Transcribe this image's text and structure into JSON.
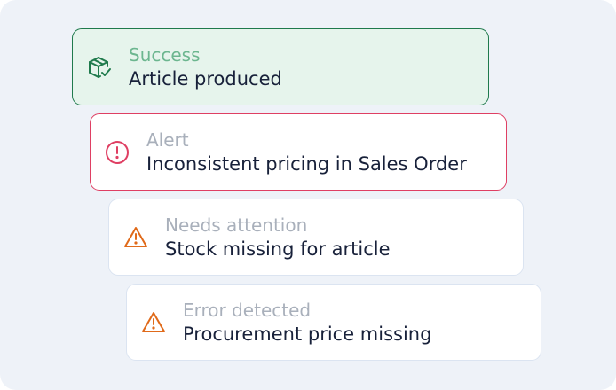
{
  "colors": {
    "success": "#1f7a4c",
    "alert": "#df3f63",
    "warning": "#e06a1a"
  },
  "notifications": [
    {
      "status": "success",
      "icon": "package-check-icon",
      "kicker": "Success",
      "title": "Article produced"
    },
    {
      "status": "alert",
      "icon": "exclamation-circle-icon",
      "kicker": "Alert",
      "title": "Inconsistent pricing in Sales Order"
    },
    {
      "status": "warning",
      "icon": "warning-triangle-icon",
      "kicker": "Needs attention",
      "title": "Stock missing for article"
    },
    {
      "status": "warning",
      "icon": "warning-triangle-icon",
      "kicker": "Error detected",
      "title": "Procurement price missing"
    }
  ]
}
